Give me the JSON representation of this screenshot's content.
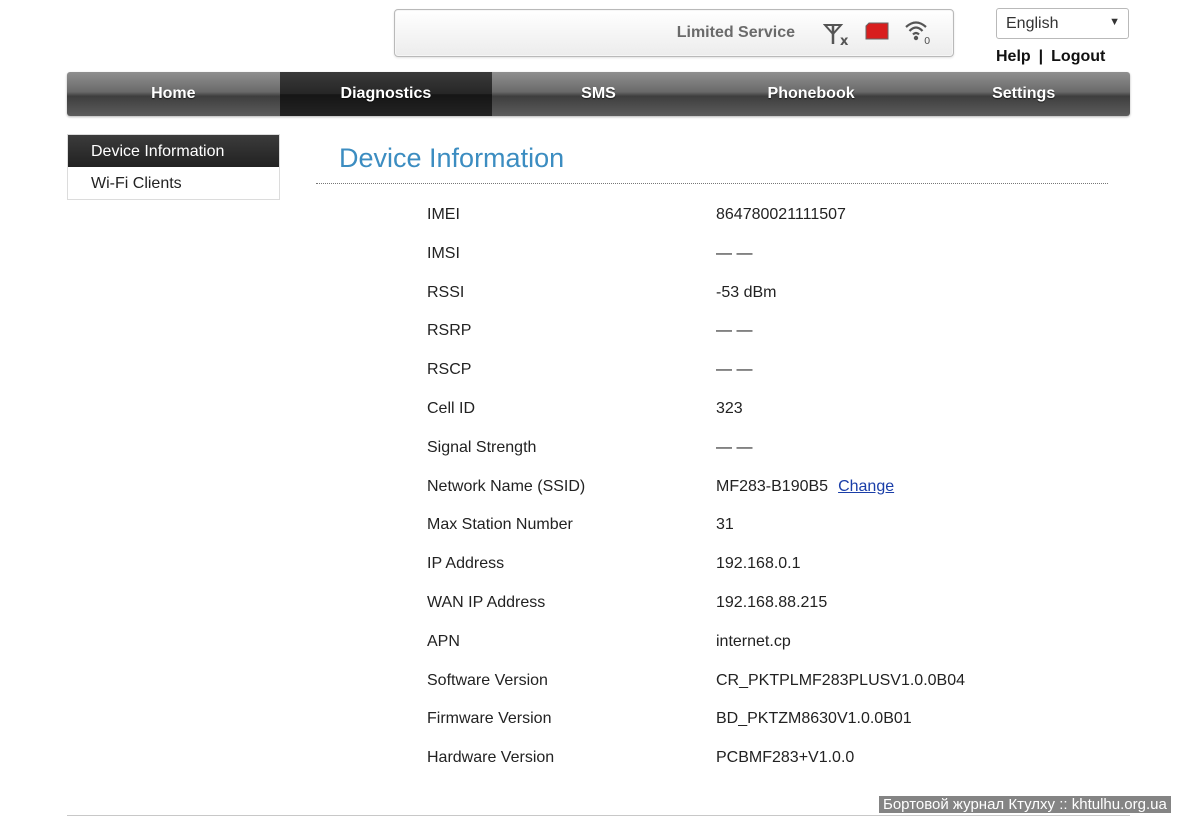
{
  "status": {
    "text": "Limited Service",
    "icons": [
      "signal-none-icon",
      "sim-card-icon",
      "wifi-icon"
    ],
    "wifi_count": "0"
  },
  "language": {
    "selected": "English"
  },
  "header_links": {
    "help": "Help",
    "separator": "|",
    "logout": "Logout"
  },
  "nav": {
    "items": [
      {
        "label": "Home"
      },
      {
        "label": "Diagnostics",
        "active": true
      },
      {
        "label": "SMS"
      },
      {
        "label": "Phonebook"
      },
      {
        "label": "Settings"
      }
    ]
  },
  "sidebar": {
    "items": [
      {
        "label": "Device Information",
        "active": true
      },
      {
        "label": "Wi-Fi Clients"
      }
    ]
  },
  "page": {
    "title": "Device Information",
    "change_link": "Change",
    "rows": [
      {
        "label": "IMEI",
        "value": "864780021111507"
      },
      {
        "label": "IMSI",
        "value": "— —"
      },
      {
        "label": "RSSI",
        "value": "-53 dBm"
      },
      {
        "label": "RSRP",
        "value": "— —"
      },
      {
        "label": "RSCP",
        "value": "— —"
      },
      {
        "label": "Cell ID",
        "value": "323"
      },
      {
        "label": "Signal Strength",
        "value": "— —"
      },
      {
        "label": "Network Name (SSID)",
        "value": "MF283-B190B5"
      },
      {
        "label": "Max Station Number",
        "value": "31"
      },
      {
        "label": "IP Address",
        "value": "192.168.0.1"
      },
      {
        "label": "WAN IP Address",
        "value": "192.168.88.215"
      },
      {
        "label": "APN",
        "value": "internet.cp"
      },
      {
        "label": "Software Version",
        "value": "CR_PKTPLMF283PLUSV1.0.0B04"
      },
      {
        "label": "Firmware Version",
        "value": "BD_PKTZM8630V1.0.0B01"
      },
      {
        "label": "Hardware Version",
        "value": "PCBMF283+V1.0.0"
      }
    ]
  },
  "watermark": "Бортовой журнал Ктулху :: khtulhu.org.ua",
  "colors": {
    "title": "#3c8dc1",
    "link": "#1a3ea8",
    "sim": "#d81e1e"
  }
}
